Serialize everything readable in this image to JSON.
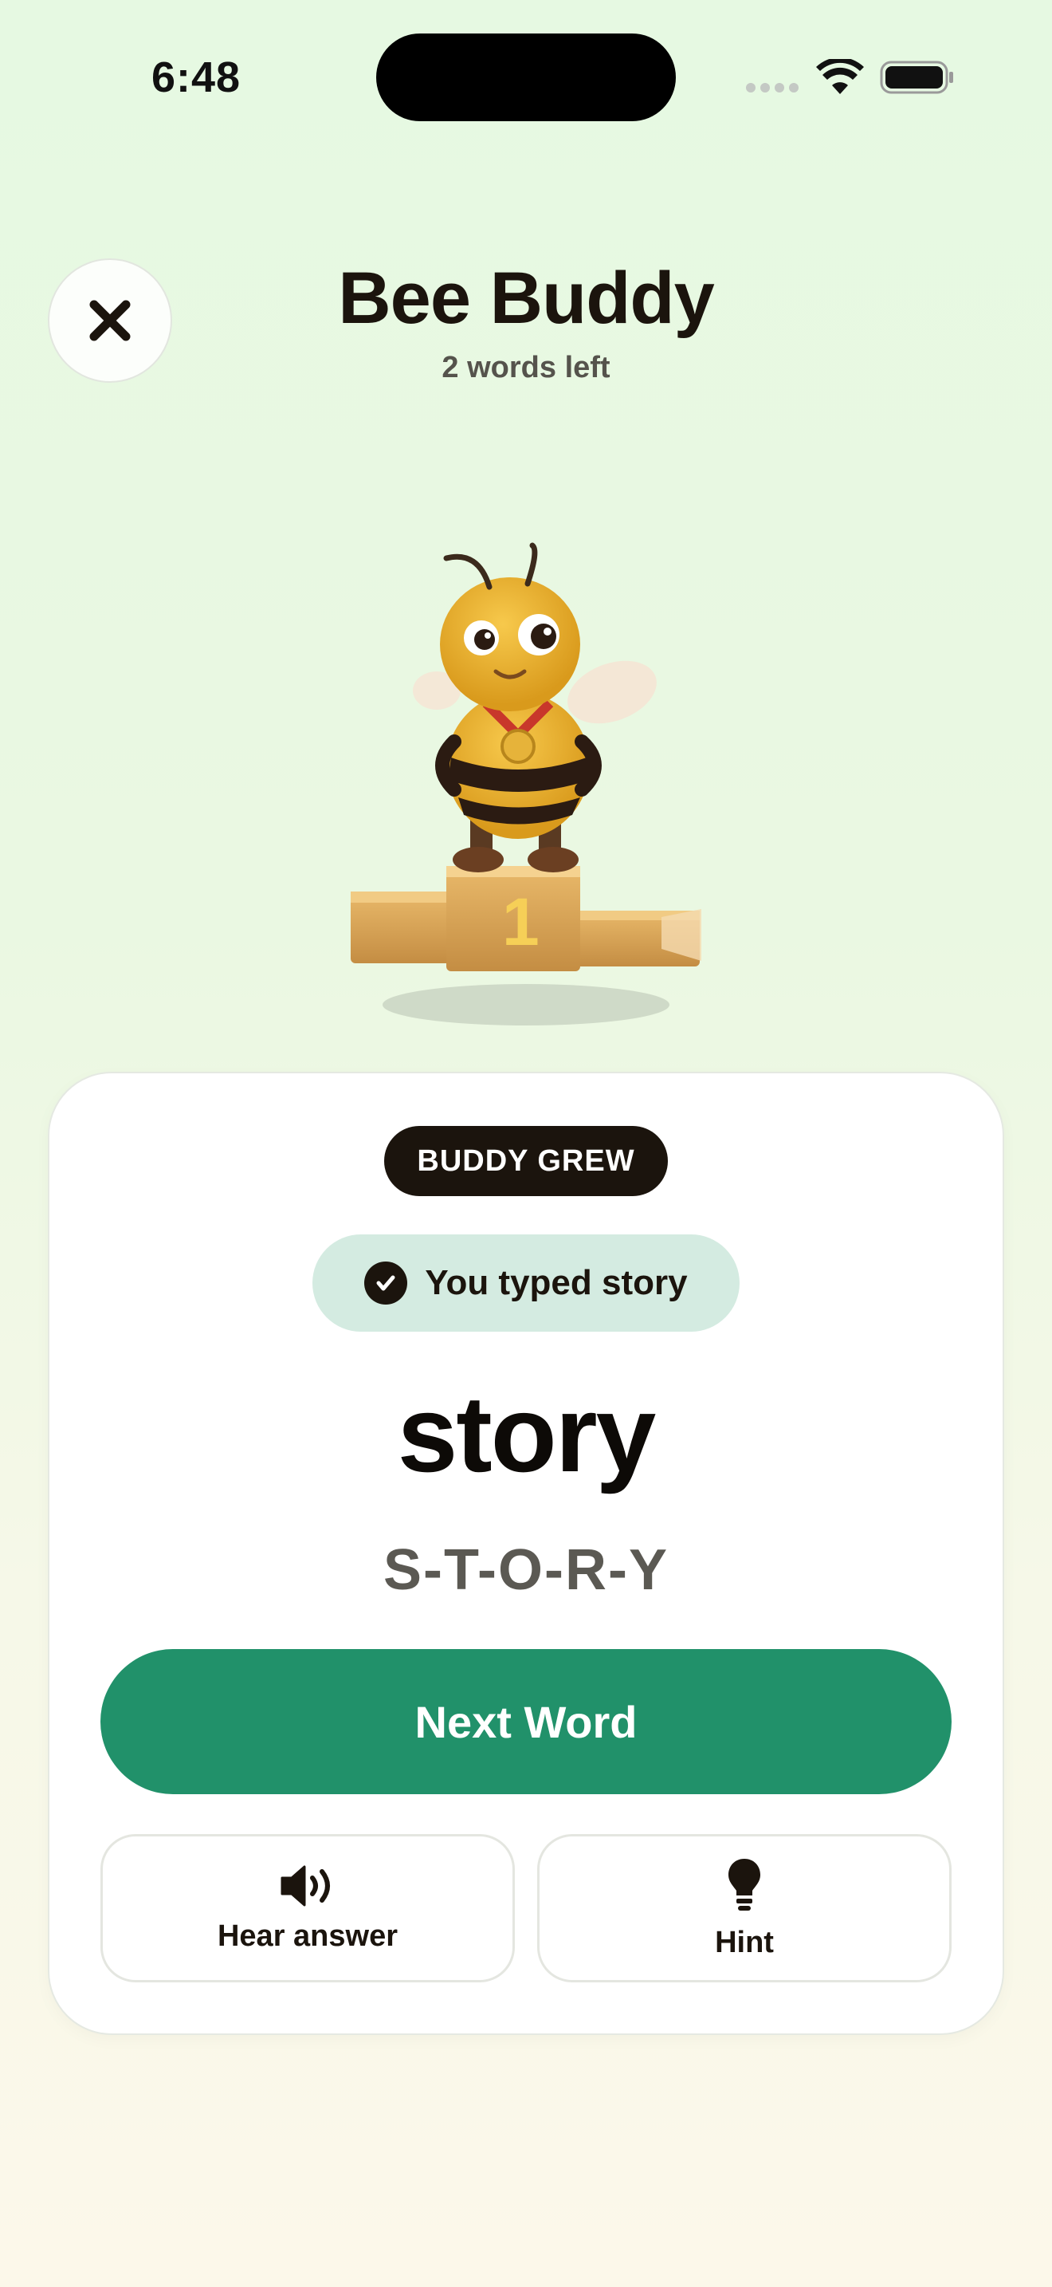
{
  "status_bar": {
    "time": "6:48"
  },
  "header": {
    "title": "Bee Buddy",
    "subtitle": "2 words left",
    "close_icon": "close-icon"
  },
  "mascot": {
    "podium_number": "1",
    "description_icon": "bee-mascot-on-podium"
  },
  "card": {
    "badge": "BUDDY GREW",
    "typed_feedback": "You typed story",
    "word": "story",
    "spelling": "S-T-O-R-Y",
    "next_button": "Next Word",
    "hear_button": "Hear answer",
    "hint_button": "Hint"
  },
  "colors": {
    "accent_green": "#21916a",
    "dark": "#1b140d",
    "chip_bg": "#d4ebe1"
  }
}
